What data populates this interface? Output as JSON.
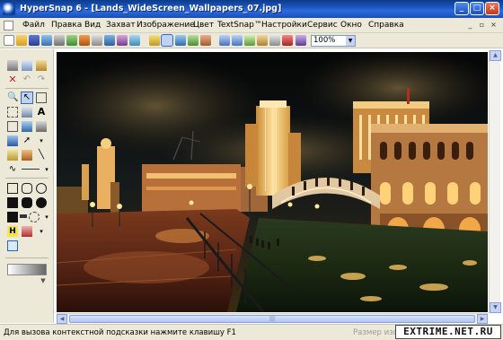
{
  "window": {
    "title": "HyperSnap 6 - [Lands_WideScreen_Wallpapers_07.jpg]"
  },
  "menu": {
    "items": [
      "Файл",
      "Правка",
      "Вид",
      "Захват",
      "Изображение",
      "Цвет",
      "TextSnap™",
      "Настройки",
      "Сервис",
      "Окно",
      "Справка"
    ]
  },
  "toolbar": {
    "zoom_value": "100%"
  },
  "status": {
    "hint": "Для вызова контекстной подсказки нажмите клавишу F1",
    "image_size_label": "Размер изо"
  },
  "watermark": {
    "text": "EXTRIME.NET.RU"
  },
  "colors": {
    "titlebar": "#1d56c2",
    "chrome": "#ece9d8",
    "selection": "#c1d2ee"
  }
}
